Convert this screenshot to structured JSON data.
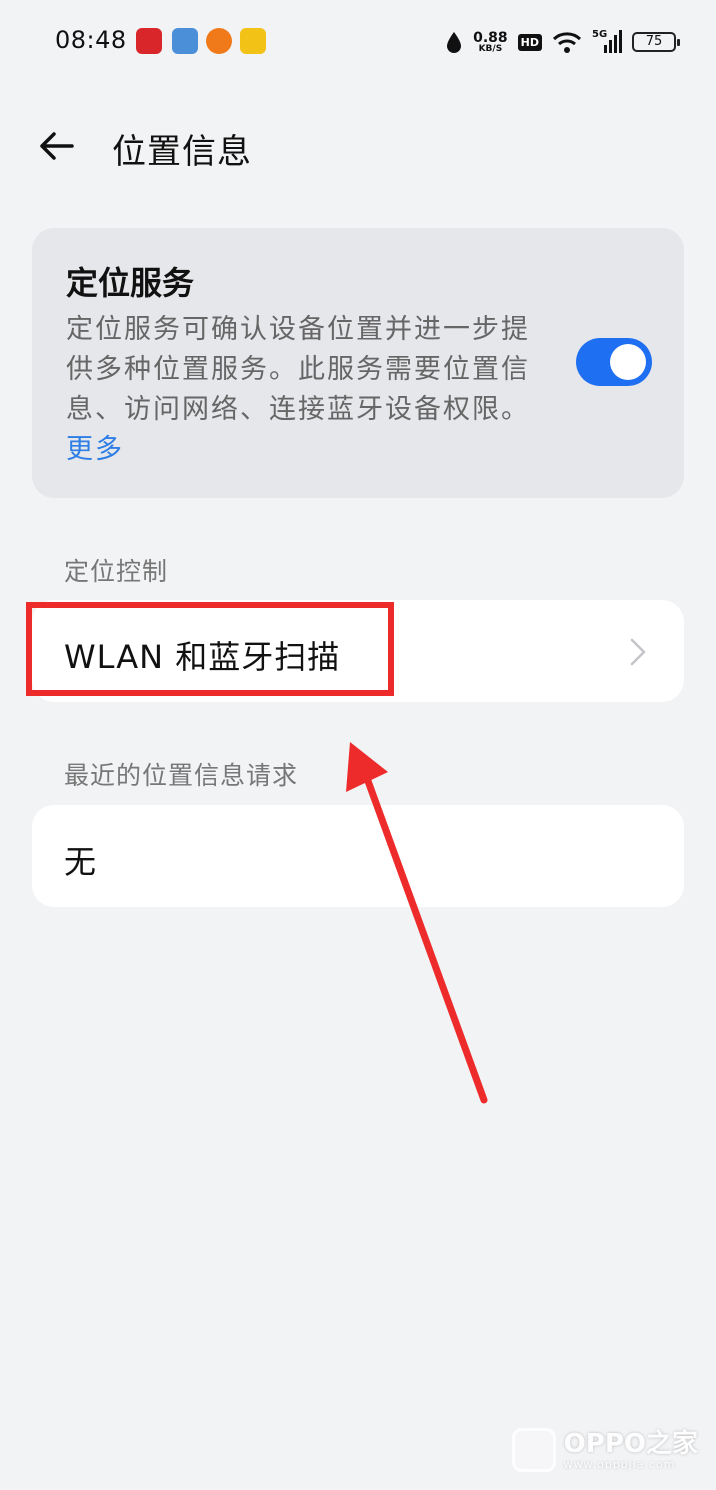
{
  "status_bar": {
    "time": "08:48",
    "net_speed_value": "0.88",
    "net_speed_unit": "KB/S",
    "hd_label": "HD",
    "signal_label": "5G",
    "battery": "75"
  },
  "header": {
    "title": "位置信息"
  },
  "location_service": {
    "title": "定位服务",
    "description": "定位服务可确认设备位置并进一步提供多种位置服务。此服务需要位置信息、访问网络、连接蓝牙设备权限。",
    "more_link": "更多",
    "enabled": true
  },
  "location_control": {
    "section_label": "定位控制",
    "wlan_item": "WLAN 和蓝牙扫描"
  },
  "recent_requests": {
    "section_label": "最近的位置信息请求",
    "empty_item": "无"
  },
  "watermark": {
    "brand": "OPPO之家",
    "url": "www.oppojia.com"
  },
  "colors": {
    "accent": "#1f6ff2",
    "link": "#2d7ee5",
    "annotation": "#ee2b2b",
    "background": "#f2f3f5"
  }
}
